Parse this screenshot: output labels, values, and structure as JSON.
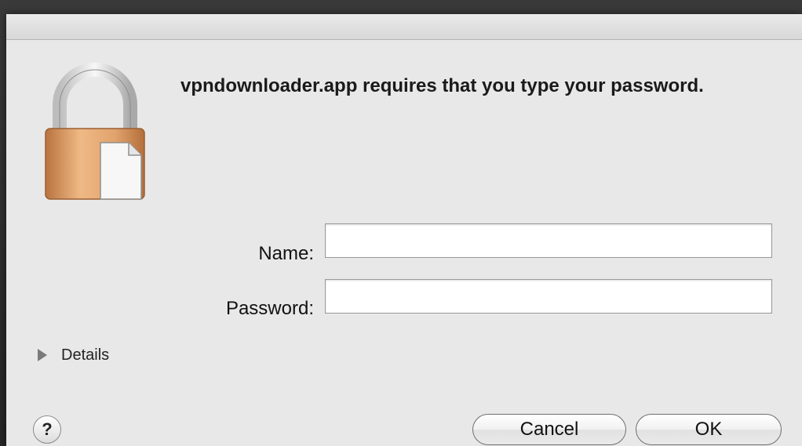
{
  "dialog": {
    "message": "vpndownloader.app requires that you type your password.",
    "name_label": "Name:",
    "name_value": "",
    "password_label": "Password:",
    "password_value": "",
    "details_label": "Details",
    "help_label": "?",
    "cancel_label": "Cancel",
    "ok_label": "OK"
  },
  "colors": {
    "lock_body": "#e3a873",
    "lock_shackle": "#c8c8c8",
    "dialog_bg": "#e8e8e8"
  },
  "icons": {
    "lock": "lock-icon",
    "details": "disclosure-triangle-icon",
    "help": "help-icon"
  }
}
